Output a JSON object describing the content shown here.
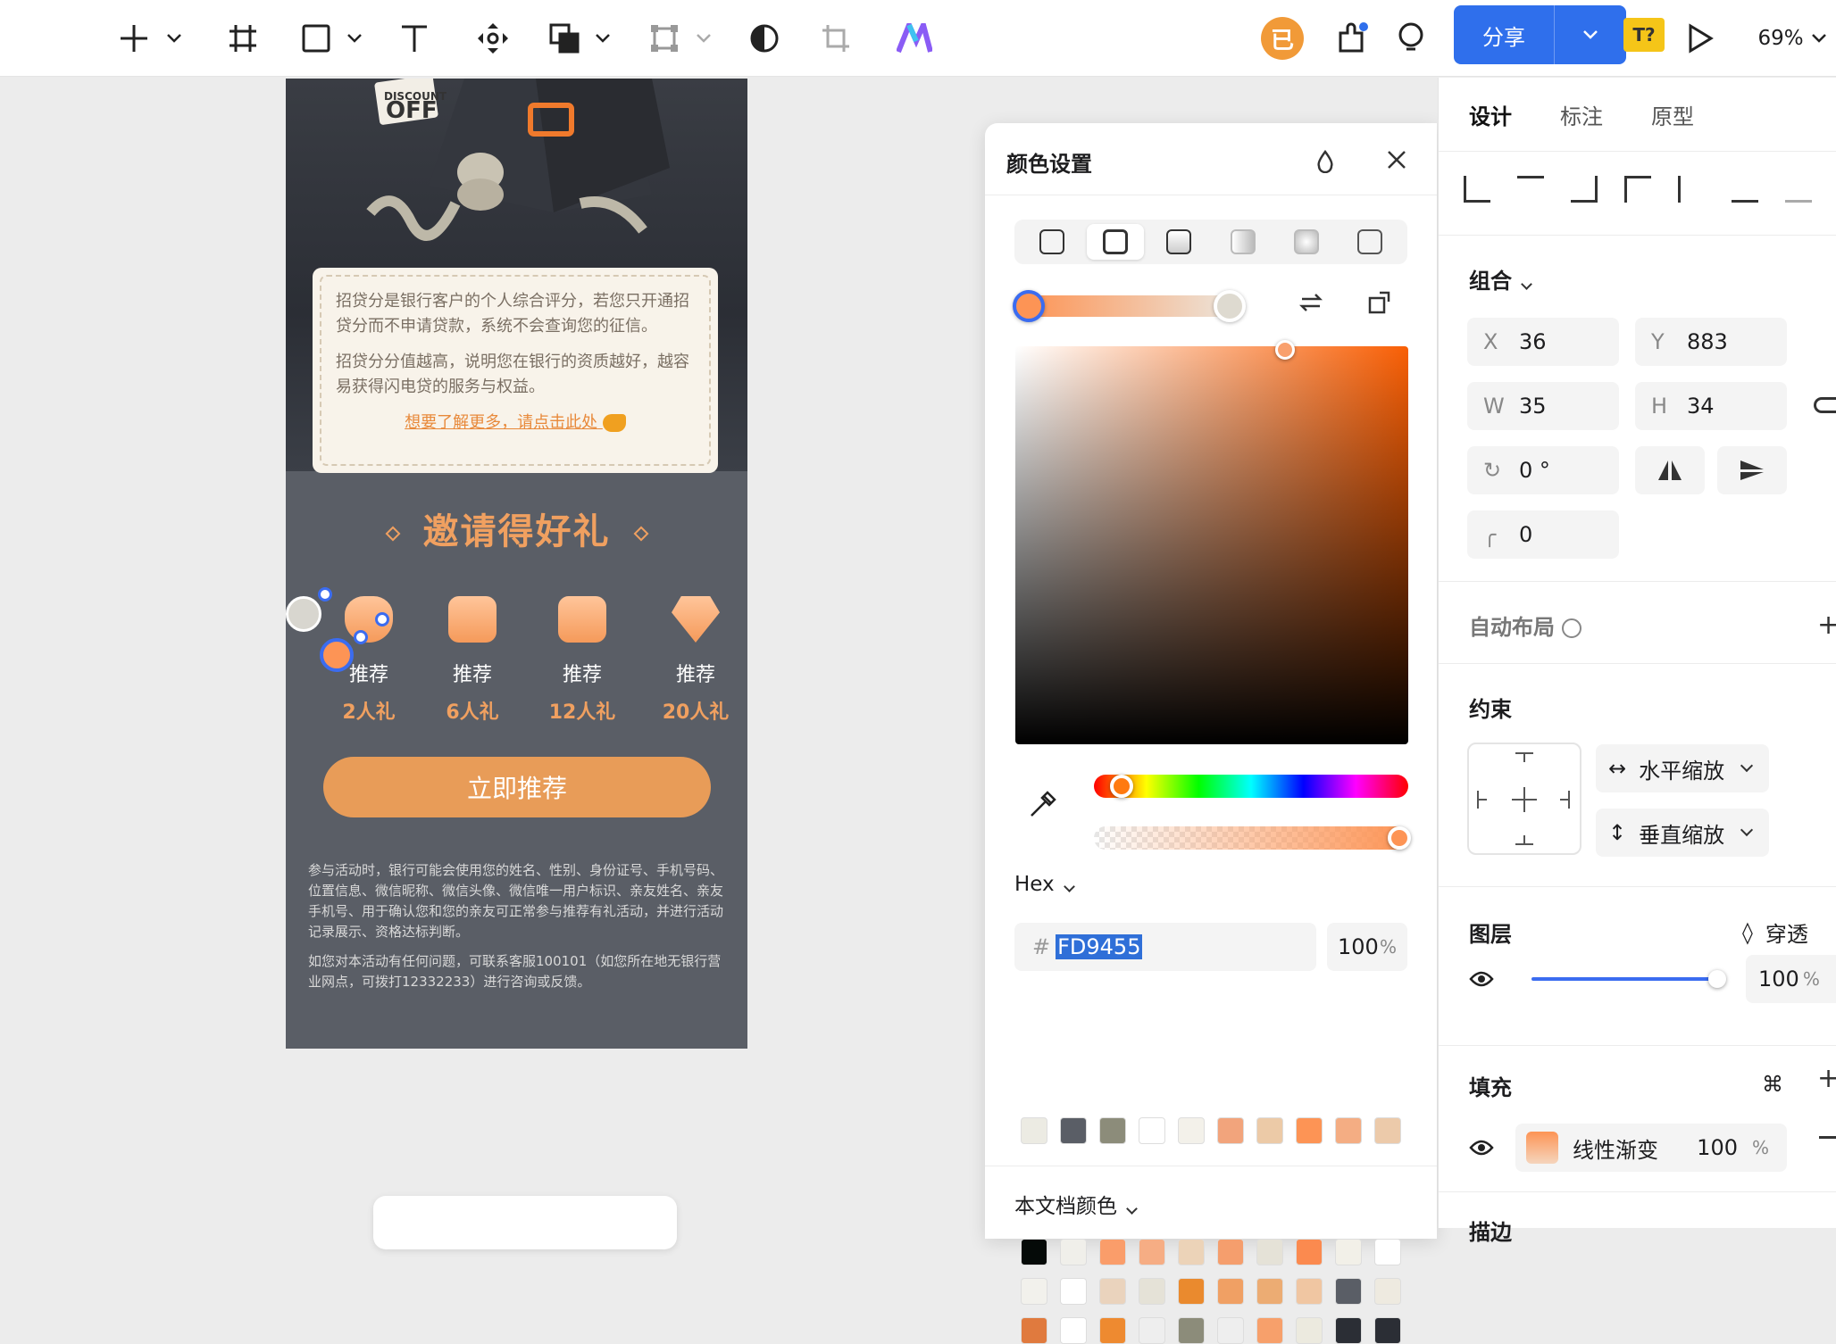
{
  "toolbar": {
    "share_label": "分享",
    "font_badge": "T?",
    "zoom": "69%",
    "user_avatar_char": "已",
    "accent": "#2f6fec"
  },
  "phone": {
    "info_p1": "招贷分是银行客户的个人综合评分，若您只开通招贷分而不申请贷款，系统不会查询您的征信。",
    "info_p2": "招贷分分值越高，说明您在银行的资质越好，越容易获得闪电贷的服务与权益。",
    "info_link": "想要了解更多，请点击此处",
    "invite_title": "邀请得好礼",
    "rewards": [
      {
        "action": "推荐",
        "gift": "2人礼"
      },
      {
        "action": "推荐",
        "gift": "6人礼"
      },
      {
        "action": "推荐",
        "gift": "12人礼"
      },
      {
        "action": "推荐",
        "gift": "20人礼"
      }
    ],
    "cta": "立即推荐",
    "terms_p1": "参与活动时，银行可能会使用您的姓名、性别、身份证号、手机号码、位置信息、微信昵称、微信头像、微信唯一用户标识、亲友姓名、亲友手机号、用于确认您和您的亲友可正常参与推荐有礼活动，并进行活动记录展示、资格达标判断。",
    "terms_p2": "如您对本活动有任何问题，可联系客服100101（如您所在地无银行营业网点，可拨打12332233）进行咨询或反馈。",
    "banner_text_1": "DISCOUNT",
    "banner_text_2": "OFF"
  },
  "color_panel": {
    "title": "颜色设置",
    "format_label": "Hex",
    "hash": "#",
    "hex_value": "FD9455",
    "opacity": "100",
    "percent": "%",
    "doc_colors_label": "本文档颜色",
    "recent_swatches": [
      "#ecebe3",
      "#5a5e66",
      "#8c8c7a",
      "#ffffff",
      "#f3f1ea",
      "#f2a47c",
      "#eccaa7",
      "#fd9455",
      "#f4ad83",
      "#eccaaa"
    ],
    "doc_swatches": [
      "#050a08",
      "#f0efea",
      "#fa9d6a",
      "#f6ad84",
      "#ecd3b8",
      "#f59e6d",
      "#e5e2d7",
      "#fb8a4f",
      "#f2f0e8",
      "#ffffff",
      "#f2f1ec",
      "#ffffff",
      "#ead3bd",
      "#e5e2d7",
      "#ea8a2e",
      "#f0a064",
      "#ecac73",
      "#f0c6a2",
      "#5a5e66",
      "#eeeae0",
      "#e07a3e",
      "#ffffff",
      "#ee8a30",
      "#eeeeee",
      "#8c8c7a",
      "#eeeeee",
      "#f7a06b",
      "#eceadf",
      "#2b2e35",
      "#2b2e35"
    ]
  },
  "right_panel": {
    "tabs": [
      "设计",
      "标注",
      "原型"
    ],
    "group_label": "组合",
    "x_label": "X",
    "x": "36",
    "y_label": "Y",
    "y": "883",
    "w_label": "W",
    "w": "35",
    "h_label": "H",
    "h": "34",
    "rotation": "0 °",
    "radius": "0",
    "auto_layout": "自动布局",
    "constraints": "约束",
    "h_scale": "水平缩放",
    "v_scale": "垂直缩放",
    "layer": "图层",
    "blend": "穿透",
    "layer_opacity": "100",
    "layer_pct": "%",
    "fill": "填充",
    "fill_type": "线性渐变",
    "fill_opacity": "100",
    "fill_pct": "%",
    "stroke": "描边"
  }
}
